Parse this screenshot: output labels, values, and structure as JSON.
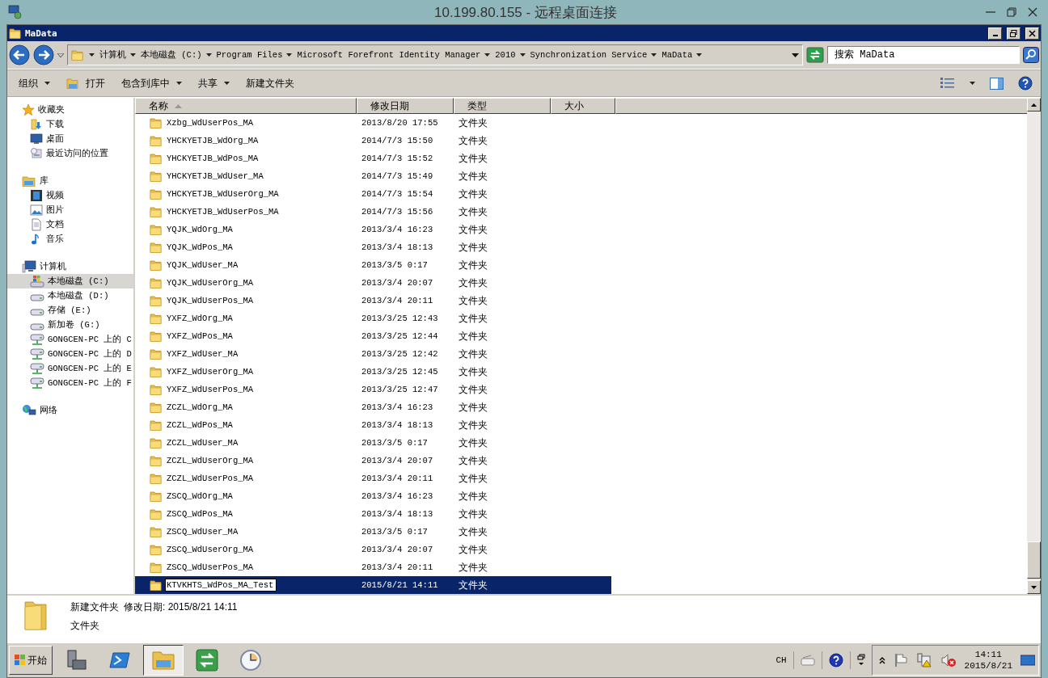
{
  "remote_window": {
    "title": "10.199.80.155 - 远程桌面连接"
  },
  "window": {
    "title": "MaData"
  },
  "address_bar": {
    "breadcrumbs": [
      "计算机",
      "本地磁盘 (C:)",
      "Program Files",
      "Microsoft Forefront Identity Manager",
      "2010",
      "Synchronization Service",
      "MaData"
    ]
  },
  "search": {
    "placeholder": "搜索 MaData"
  },
  "toolbar": [
    {
      "label": "组织",
      "kind": "menu"
    },
    {
      "label": "打开",
      "kind": "open"
    },
    {
      "label": "包含到库中",
      "kind": "menu"
    },
    {
      "label": "共享",
      "kind": "menu"
    },
    {
      "label": "新建文件夹",
      "kind": "plain"
    }
  ],
  "sidebar": {
    "groups": [
      {
        "label": "收藏夹",
        "kind": "favorites",
        "selected": false,
        "children": [
          {
            "label": "下载",
            "kind": "download",
            "selected": false
          },
          {
            "label": "桌面",
            "kind": "desktop",
            "selected": false
          },
          {
            "label": "最近访问的位置",
            "kind": "recent",
            "selected": false
          }
        ]
      },
      {
        "label": "库",
        "kind": "library",
        "selected": false,
        "children": [
          {
            "label": "视频",
            "kind": "video",
            "selected": false
          },
          {
            "label": "图片",
            "kind": "picture",
            "selected": false
          },
          {
            "label": "文档",
            "kind": "document",
            "selected": false
          },
          {
            "label": "音乐",
            "kind": "music",
            "selected": false
          }
        ]
      },
      {
        "label": "计算机",
        "kind": "computer",
        "selected": false,
        "children": [
          {
            "label": "本地磁盘 (C:)",
            "kind": "system-drive",
            "selected": true
          },
          {
            "label": "本地磁盘 (D:)",
            "kind": "drive",
            "selected": false
          },
          {
            "label": "存储 (E:)",
            "kind": "drive",
            "selected": false
          },
          {
            "label": "新加卷 (G:)",
            "kind": "drive",
            "selected": false
          },
          {
            "label": "GONGCEN-PC 上的 C",
            "kind": "network-drive",
            "selected": false
          },
          {
            "label": "GONGCEN-PC 上的 D",
            "kind": "network-drive",
            "selected": false
          },
          {
            "label": "GONGCEN-PC 上的 E",
            "kind": "network-drive",
            "selected": false
          },
          {
            "label": "GONGCEN-PC 上的 F",
            "kind": "network-drive",
            "selected": false
          }
        ]
      },
      {
        "label": "网络",
        "kind": "network",
        "selected": false
      }
    ]
  },
  "table": {
    "columns": [
      {
        "label": "名称",
        "sorted": true
      },
      {
        "label": "修改日期",
        "sorted": false
      },
      {
        "label": "类型",
        "sorted": false
      },
      {
        "label": "大小",
        "sorted": false
      }
    ],
    "rows": [
      {
        "name": "Xzbg_WdUserPos_MA",
        "date": "2013/8/20 17:55",
        "type": "文件夹",
        "selected": false,
        "renaming": false
      },
      {
        "name": "YHCKYETJB_WdOrg_MA",
        "date": "2014/7/3 15:50",
        "type": "文件夹",
        "selected": false,
        "renaming": false
      },
      {
        "name": "YHCKYETJB_WdPos_MA",
        "date": "2014/7/3 15:52",
        "type": "文件夹",
        "selected": false,
        "renaming": false
      },
      {
        "name": "YHCKYETJB_WdUser_MA",
        "date": "2014/7/3 15:49",
        "type": "文件夹",
        "selected": false,
        "renaming": false
      },
      {
        "name": "YHCKYETJB_WdUserOrg_MA",
        "date": "2014/7/3 15:54",
        "type": "文件夹",
        "selected": false,
        "renaming": false
      },
      {
        "name": "YHCKYETJB_WdUserPos_MA",
        "date": "2014/7/3 15:56",
        "type": "文件夹",
        "selected": false,
        "renaming": false
      },
      {
        "name": "YQJK_WdOrg_MA",
        "date": "2013/3/4 16:23",
        "type": "文件夹",
        "selected": false,
        "renaming": false
      },
      {
        "name": "YQJK_WdPos_MA",
        "date": "2013/3/4 18:13",
        "type": "文件夹",
        "selected": false,
        "renaming": false
      },
      {
        "name": "YQJK_WdUser_MA",
        "date": "2013/3/5 0:17",
        "type": "文件夹",
        "selected": false,
        "renaming": false
      },
      {
        "name": "YQJK_WdUserOrg_MA",
        "date": "2013/3/4 20:07",
        "type": "文件夹",
        "selected": false,
        "renaming": false
      },
      {
        "name": "YQJK_WdUserPos_MA",
        "date": "2013/3/4 20:11",
        "type": "文件夹",
        "selected": false,
        "renaming": false
      },
      {
        "name": "YXFZ_WdOrg_MA",
        "date": "2013/3/25 12:43",
        "type": "文件夹",
        "selected": false,
        "renaming": false
      },
      {
        "name": "YXFZ_WdPos_MA",
        "date": "2013/3/25 12:44",
        "type": "文件夹",
        "selected": false,
        "renaming": false
      },
      {
        "name": "YXFZ_WdUser_MA",
        "date": "2013/3/25 12:42",
        "type": "文件夹",
        "selected": false,
        "renaming": false
      },
      {
        "name": "YXFZ_WdUserOrg_MA",
        "date": "2013/3/25 12:45",
        "type": "文件夹",
        "selected": false,
        "renaming": false
      },
      {
        "name": "YXFZ_WdUserPos_MA",
        "date": "2013/3/25 12:47",
        "type": "文件夹",
        "selected": false,
        "renaming": false
      },
      {
        "name": "ZCZL_WdOrg_MA",
        "date": "2013/3/4 16:23",
        "type": "文件夹",
        "selected": false,
        "renaming": false
      },
      {
        "name": "ZCZL_WdPos_MA",
        "date": "2013/3/4 18:13",
        "type": "文件夹",
        "selected": false,
        "renaming": false
      },
      {
        "name": "ZCZL_WdUser_MA",
        "date": "2013/3/5 0:17",
        "type": "文件夹",
        "selected": false,
        "renaming": false
      },
      {
        "name": "ZCZL_WdUserOrg_MA",
        "date": "2013/3/4 20:07",
        "type": "文件夹",
        "selected": false,
        "renaming": false
      },
      {
        "name": "ZCZL_WdUserPos_MA",
        "date": "2013/3/4 20:11",
        "type": "文件夹",
        "selected": false,
        "renaming": false
      },
      {
        "name": "ZSCQ_WdOrg_MA",
        "date": "2013/3/4 16:23",
        "type": "文件夹",
        "selected": false,
        "renaming": false
      },
      {
        "name": "ZSCQ_WdPos_MA",
        "date": "2013/3/4 18:13",
        "type": "文件夹",
        "selected": false,
        "renaming": false
      },
      {
        "name": "ZSCQ_WdUser_MA",
        "date": "2013/3/5 0:17",
        "type": "文件夹",
        "selected": false,
        "renaming": false
      },
      {
        "name": "ZSCQ_WdUserOrg_MA",
        "date": "2013/3/4 20:07",
        "type": "文件夹",
        "selected": false,
        "renaming": false
      },
      {
        "name": "ZSCQ_WdUserPos_MA",
        "date": "2013/3/4 20:11",
        "type": "文件夹",
        "selected": false,
        "renaming": false
      },
      {
        "name": "KTVKHTS_WdPos_MA_Test",
        "date": "2015/8/21 14:11",
        "type": "文件夹",
        "selected": true,
        "renaming": true
      }
    ]
  },
  "details": {
    "name": "新建文件夹",
    "modified": "修改日期: 2015/8/21 14:11",
    "type": "文件夹"
  },
  "taskbar": {
    "start": "开始",
    "apps": [
      {
        "kind": "server-manager",
        "selected": false
      },
      {
        "kind": "powershell",
        "selected": false
      },
      {
        "kind": "explorer",
        "selected": true
      },
      {
        "kind": "sync",
        "selected": false
      },
      {
        "kind": "clock",
        "selected": false
      }
    ],
    "language": "CH",
    "time": "14:11",
    "date": "2015/8/21"
  }
}
